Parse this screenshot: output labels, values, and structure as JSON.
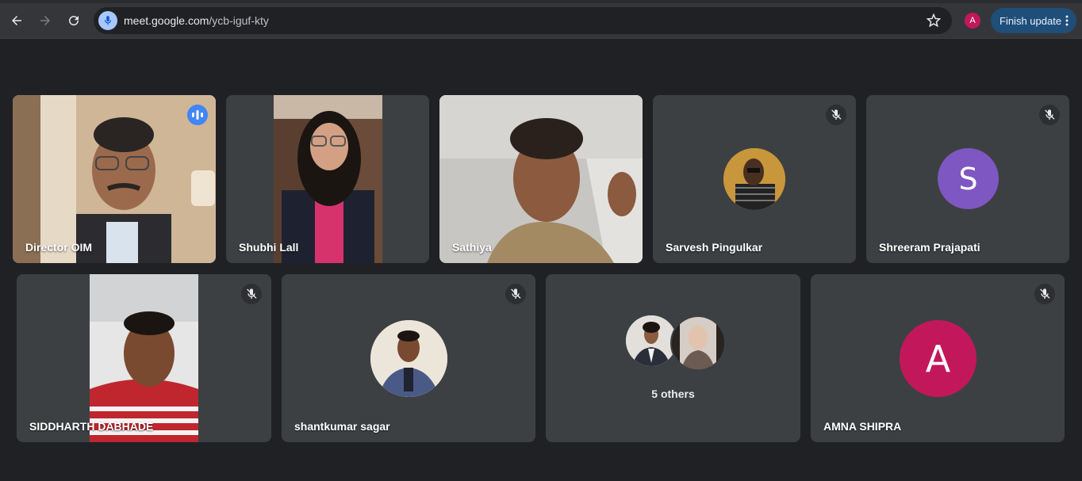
{
  "browser": {
    "url_host": "meet.google.com",
    "url_path": "/ycb-iguf-kty",
    "profile_initial": "A",
    "profile_color": "#c2185b",
    "finish_update_label": "Finish update"
  },
  "participants_row1": [
    {
      "name": "Director OIM",
      "speaking": true,
      "muted": false,
      "type": "video"
    },
    {
      "name": "Shubhi Lall",
      "speaking": false,
      "muted": false,
      "type": "video"
    },
    {
      "name": "Sathiya",
      "speaking": false,
      "muted": false,
      "type": "video"
    },
    {
      "name": "Sarvesh Pingulkar",
      "speaking": false,
      "muted": true,
      "type": "photo-avatar"
    },
    {
      "name": "Shreeram Prajapati",
      "speaking": false,
      "muted": true,
      "type": "letter-avatar",
      "initial": "S",
      "avatar_color": "#7e57c2"
    }
  ],
  "participants_row2": [
    {
      "name": "SIDDHARTH DABHADE",
      "speaking": false,
      "muted": true,
      "type": "video"
    },
    {
      "name": "shantkumar sagar",
      "speaking": false,
      "muted": true,
      "type": "photo-avatar"
    },
    {
      "name": "5 others",
      "type": "group"
    },
    {
      "name": "AMNA SHIPRA",
      "speaking": false,
      "muted": true,
      "type": "letter-avatar",
      "initial": "A",
      "avatar_color": "#c2185b"
    }
  ],
  "colors": {
    "background": "#202124",
    "tile": "#3c4043",
    "active_outline": "#8ab4f8",
    "speaking_indicator": "#4285f4"
  }
}
